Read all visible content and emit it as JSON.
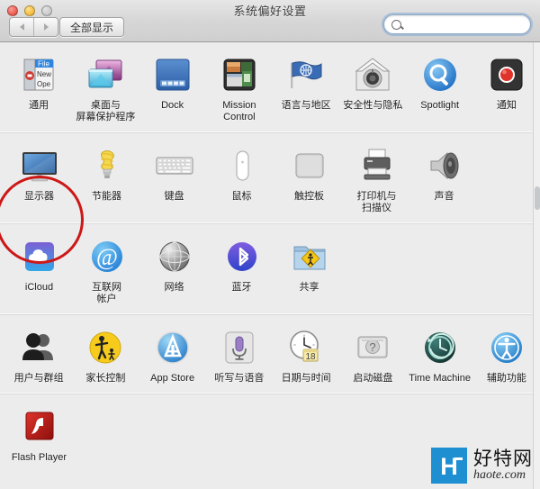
{
  "window": {
    "title": "系统偏好设置",
    "traffic_lights": [
      "close",
      "minimize",
      "zoom"
    ]
  },
  "toolbar": {
    "back_label": "◀",
    "forward_label": "▶",
    "show_all_label": "全部显示",
    "search": {
      "value": "",
      "placeholder": "",
      "icon": "search-icon"
    }
  },
  "sections": [
    {
      "name": "personal",
      "items": [
        {
          "label": "通用",
          "icon": "general-icon"
        },
        {
          "label": "桌面与\n屏幕保护程序",
          "line1": "桌面与",
          "line2": "屏幕保护程序",
          "icon": "desktop-screensaver-icon"
        },
        {
          "label": "Dock",
          "icon": "dock-icon"
        },
        {
          "label": "Mission\nControl",
          "line1": "Mission",
          "line2": "Control",
          "icon": "mission-control-icon"
        },
        {
          "label": "语言与地区",
          "icon": "language-region-icon"
        },
        {
          "label": "安全性与隐私",
          "icon": "security-privacy-icon"
        },
        {
          "label": "Spotlight",
          "icon": "spotlight-icon"
        },
        {
          "label": "通知",
          "icon": "notifications-icon"
        }
      ]
    },
    {
      "name": "hardware",
      "items": [
        {
          "label": "显示器",
          "icon": "displays-icon",
          "highlighted": true
        },
        {
          "label": "节能器",
          "icon": "energy-saver-icon"
        },
        {
          "label": "键盘",
          "icon": "keyboard-icon"
        },
        {
          "label": "鼠标",
          "icon": "mouse-icon"
        },
        {
          "label": "触控板",
          "icon": "trackpad-icon"
        },
        {
          "label": "打印机与\n扫描仪",
          "line1": "打印机与",
          "line2": "扫描仪",
          "icon": "printers-scanners-icon"
        },
        {
          "label": "声音",
          "icon": "sound-icon"
        }
      ]
    },
    {
      "name": "internet-wireless",
      "items": [
        {
          "label": "iCloud",
          "icon": "icloud-icon"
        },
        {
          "label": "互联网\n帐户",
          "line1": "互联网",
          "line2": "帐户",
          "icon": "internet-accounts-icon"
        },
        {
          "label": "网络",
          "icon": "network-icon"
        },
        {
          "label": "蓝牙",
          "icon": "bluetooth-icon"
        },
        {
          "label": "共享",
          "icon": "sharing-icon"
        }
      ]
    },
    {
      "name": "system",
      "items": [
        {
          "label": "用户与群组",
          "icon": "users-groups-icon"
        },
        {
          "label": "家长控制",
          "icon": "parental-controls-icon"
        },
        {
          "label": "App Store",
          "icon": "app-store-icon"
        },
        {
          "label": "听写与语音",
          "icon": "dictation-speech-icon"
        },
        {
          "label": "日期与时间",
          "icon": "date-time-icon",
          "badge": "18"
        },
        {
          "label": "启动磁盘",
          "icon": "startup-disk-icon"
        },
        {
          "label": "Time Machine",
          "icon": "time-machine-icon"
        },
        {
          "label": "辅助功能",
          "icon": "accessibility-icon"
        }
      ]
    },
    {
      "name": "other",
      "items": [
        {
          "label": "Flash Player",
          "icon": "flash-player-icon"
        }
      ]
    }
  ],
  "annotation": {
    "shape": "ellipse",
    "color": "#cc1817",
    "target": "显示器"
  },
  "watermark": {
    "logo_letter": "H",
    "site_cn": "好特网",
    "site_en": "haote.com",
    "color": "#1e90d2"
  }
}
